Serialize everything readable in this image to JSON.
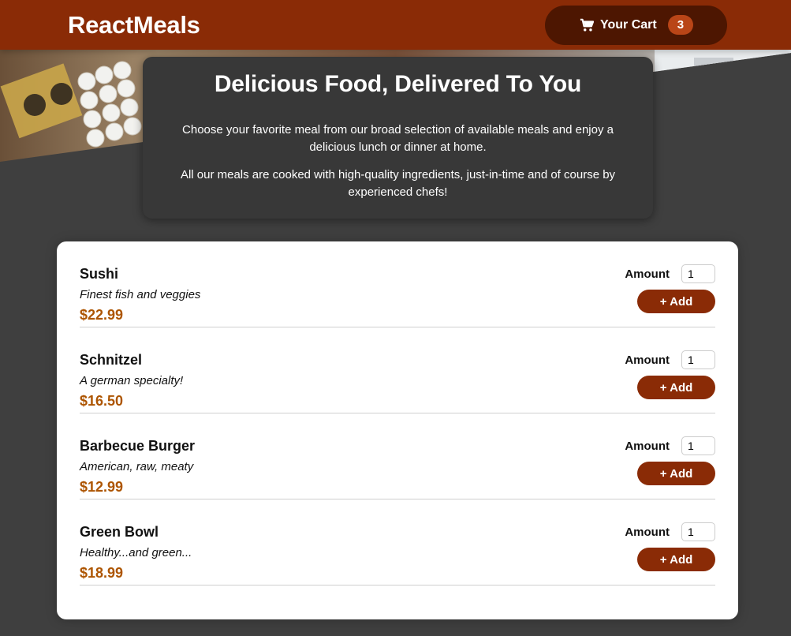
{
  "header": {
    "logo": "ReactMeals",
    "cart_label": "Your Cart",
    "cart_count": "3"
  },
  "summary": {
    "title": "Delicious Food, Delivered To You",
    "paragraph1": "Choose your favorite meal from our broad selection of available meals and enjoy a delicious lunch or dinner at home.",
    "paragraph2": "All our meals are cooked with high-quality ingredients, just-in-time and of course by experienced chefs!"
  },
  "meals": [
    {
      "name": "Sushi",
      "description": "Finest fish and veggies",
      "price": "$22.99",
      "amount_label": "Amount",
      "amount": "1",
      "add_label": "+ Add"
    },
    {
      "name": "Schnitzel",
      "description": "A german specialty!",
      "price": "$16.50",
      "amount_label": "Amount",
      "amount": "1",
      "add_label": "+ Add"
    },
    {
      "name": "Barbecue Burger",
      "description": "American, raw, meaty",
      "price": "$12.99",
      "amount_label": "Amount",
      "amount": "1",
      "add_label": "+ Add"
    },
    {
      "name": "Green Bowl",
      "description": "Healthy...and green...",
      "price": "$18.99",
      "amount_label": "Amount",
      "amount": "1",
      "add_label": "+ Add"
    }
  ],
  "colors": {
    "header": "#8a2b06",
    "cart_button": "#4d1601",
    "badge": "#b94517",
    "price": "#ad5502",
    "page_bg": "#3f3f3f",
    "summary_bg": "#383838"
  },
  "icons": {
    "cart": "shopping-cart-icon"
  }
}
